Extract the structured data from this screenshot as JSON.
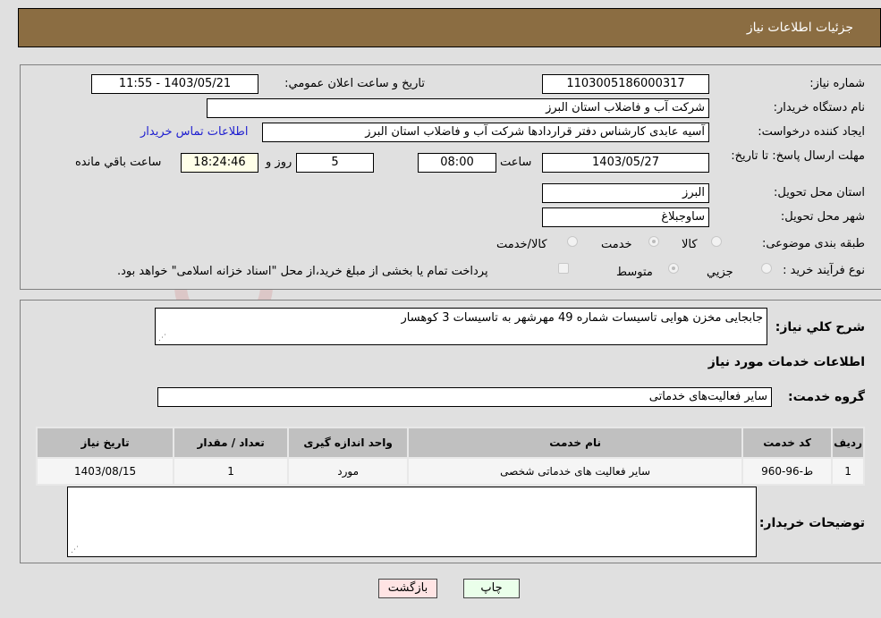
{
  "header": {
    "title": "جزئیات اطلاعات نیاز"
  },
  "form": {
    "need_number": {
      "label": "شماره نیاز:",
      "value": "1103005186000317"
    },
    "announce_datetime": {
      "label": "تاریخ و ساعت اعلان عمومي:",
      "value": "1403/05/21 - 11:55"
    },
    "buyer_org": {
      "label": "نام دستگاه خريدار:",
      "value": "شرکت آب و فاضلاب استان البرز"
    },
    "requester": {
      "label": "ایجاد کننده درخواست:",
      "value": "آسیه عابدی کارشناس دفتر قراردادها شرکت آب و فاضلاب استان البرز"
    },
    "buyer_contact_link": "اطلاعات تماس خریدار",
    "deadline": {
      "label": "مهلت ارسال پاسخ: تا تاریخ:",
      "date": "1403/05/27",
      "time_label": "ساعت",
      "time": "08:00",
      "days": "5",
      "days_label": "روز و",
      "remaining": "18:24:46",
      "remaining_label": "ساعت باقي مانده"
    },
    "province": {
      "label": "استان محل تحویل:",
      "value": "البرز"
    },
    "city": {
      "label": "شهر محل تحویل:",
      "value": "ساوجبلاغ"
    },
    "category": {
      "label": "طبقه بندی موضوعی:",
      "options": [
        "کالا",
        "خدمت",
        "کالا/خدمت"
      ],
      "selected": "خدمت"
    },
    "purchase_type": {
      "label": "نوع فرآیند خرید :",
      "options": [
        "جزيي",
        "متوسط"
      ],
      "selected": "متوسط",
      "treasury_note": "پرداخت تمام یا بخشی از مبلغ خرید،از محل \"اسناد خزانه اسلامی\" خواهد بود."
    }
  },
  "details": {
    "description_label": "شرح کلي نياز:",
    "description": "جابجایی مخزن هوایی تاسیسات شماره 49 مهرشهر به تاسیسات 3 کوهسار",
    "services_heading": "اطلاعات خدمات مورد نیاز",
    "service_group_label": "گروه خدمت:",
    "service_group": "سایر فعالیت‌های خدماتی",
    "table": {
      "headers": [
        "ردیف",
        "کد خدمت",
        "نام خدمت",
        "واحد اندازه گیری",
        "تعداد / مقدار",
        "تاریخ نیاز"
      ],
      "rows": [
        [
          "1",
          "ط-96-960",
          "سایر فعالیت های خدماتی شخصی",
          "مورد",
          "1",
          "1403/08/15"
        ]
      ]
    },
    "buyer_notes_label": "توضیحات خریدار:",
    "buyer_notes": ""
  },
  "buttons": {
    "print": "چاپ",
    "back": "بازگشت"
  },
  "watermark": "AriaTender.neT",
  "colors": {
    "header_bg": "#8b6d42",
    "print_bg": "#eaffea",
    "back_bg": "#ffe4e4",
    "link": "#2020d0"
  }
}
